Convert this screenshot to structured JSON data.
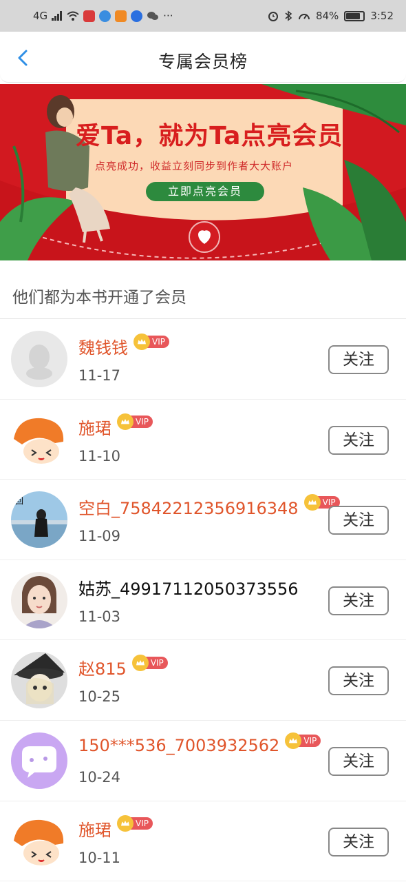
{
  "status_bar": {
    "network": "4G",
    "battery_text": "84%",
    "battery_level": 0.84,
    "time": "3:52",
    "more": "···"
  },
  "header": {
    "title": "专属会员榜"
  },
  "banner": {
    "headline": "爱Ta，就为Ta点亮会员",
    "subtitle": "点亮成功，收益立刻同步到作者大大账户",
    "cta": "立即点亮会员",
    "colors": {
      "background": "#d21920",
      "panel": "#fcd9b6",
      "cta": "#2d8a3e"
    }
  },
  "section": {
    "title": "他们都为本书开通了会员"
  },
  "members": [
    {
      "name": "魏钱钱",
      "date": "11-17",
      "vip": true,
      "vip_label": "VIP",
      "follow_label": "关注",
      "avatar": "default-avatar-icon"
    },
    {
      "name": "施珺",
      "date": "11-10",
      "vip": true,
      "vip_label": "VIP",
      "follow_label": "关注",
      "avatar": "cartoon-avatar"
    },
    {
      "name": "空白_7584221235691634​8",
      "date": "11-09",
      "vip": true,
      "vip_label": "VIP",
      "follow_label": "关注",
      "avatar": "photo-avatar"
    },
    {
      "name": "姑苏_49917112050373556",
      "date": "11-03",
      "vip": false,
      "vip_label": "",
      "follow_label": "关注",
      "avatar": "portrait-avatar"
    },
    {
      "name": "赵815",
      "date": "10-25",
      "vip": true,
      "vip_label": "VIP",
      "follow_label": "关注",
      "avatar": "anime-avatar"
    },
    {
      "name": "150***536_7003932562",
      "date": "10-24",
      "vip": true,
      "vip_label": "VIP",
      "follow_label": "关注",
      "avatar": "chat-bubble-avatar"
    },
    {
      "name": "施珺",
      "date": "10-11",
      "vip": true,
      "vip_label": "VIP",
      "follow_label": "关注",
      "avatar": "cartoon-avatar"
    }
  ],
  "colors": {
    "vip_name": "#e0552b",
    "plain_name": "#111111",
    "vip_pill": "#e8575a",
    "crown": "#f6c23a",
    "back_arrow": "#2f8fe6"
  }
}
